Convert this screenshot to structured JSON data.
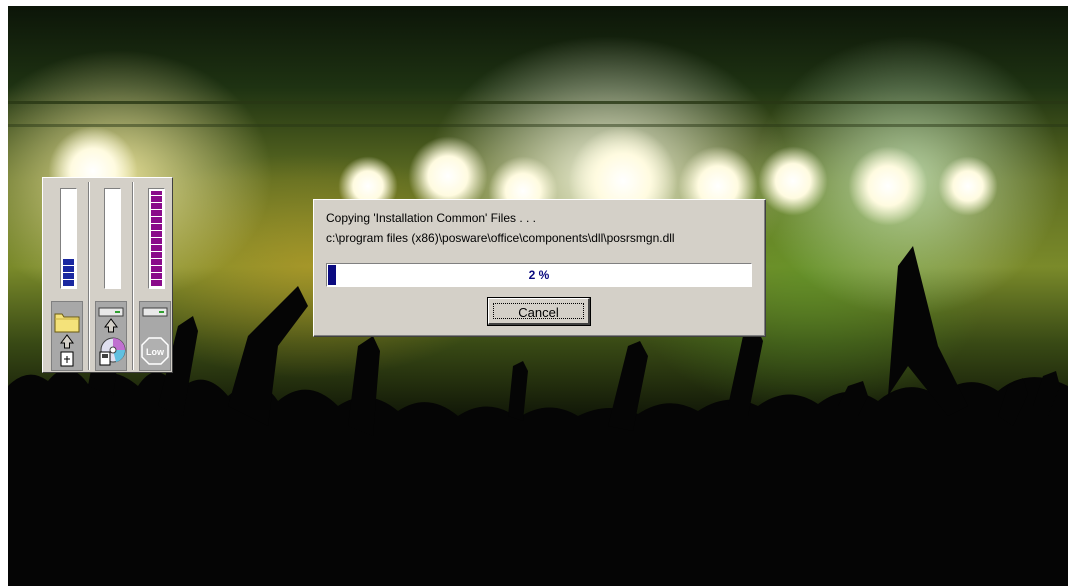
{
  "desktop": {
    "wallpaper": "concert-crowd-stage-lights"
  },
  "disk_meter": {
    "gauges": [
      {
        "name": "source",
        "level_percent": 30,
        "segment_color": "#1a28a0",
        "icon": "folder-upload-icon"
      },
      {
        "name": "destination",
        "level_percent": 0,
        "segment_color": "#1a28a0",
        "icon": "disk-to-drive-icon"
      },
      {
        "name": "free-space",
        "level_percent": 100,
        "segment_color": "#8a0a8a",
        "icon": "drive-low-icon"
      }
    ],
    "low_label": "Low"
  },
  "dialog": {
    "status_line": "Copying 'Installation Common' Files . . .",
    "file_path": "c:\\program files (x86)\\posware\\office\\components\\dll\\posrsmgn.dll",
    "progress_percent": 2,
    "progress_text": "2 %",
    "cancel_label": "Cancel",
    "progress_color": "#0a0a80"
  }
}
